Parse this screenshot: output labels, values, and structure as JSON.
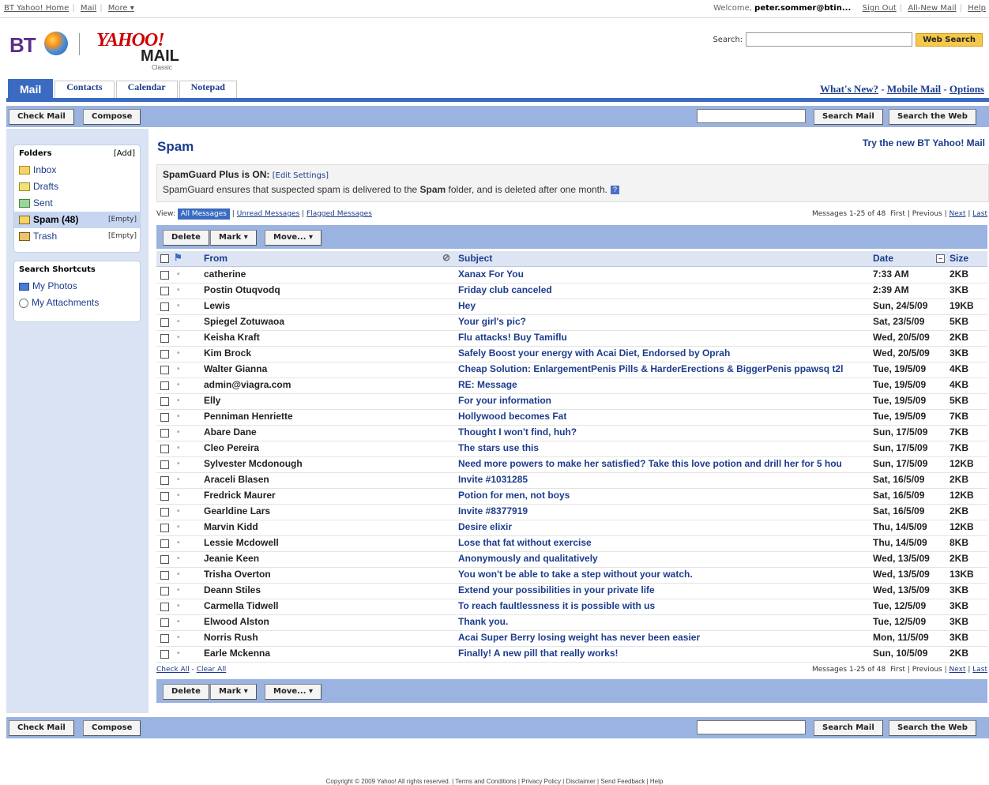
{
  "util": {
    "left_links": [
      "BT Yahoo! Home",
      "Mail",
      "More"
    ],
    "welcome": "Welcome,",
    "user": "peter.sommer@btin...",
    "right_links": [
      "Sign Out",
      "All-New Mail",
      "Help"
    ]
  },
  "logo": {
    "bt": "BT",
    "yahoo": "YAHOO!",
    "mail": "MAIL",
    "classic": "Classic"
  },
  "top_search": {
    "label": "Search:",
    "button": "Web Search"
  },
  "tabs": [
    "Mail",
    "Contacts",
    "Calendar",
    "Notepad"
  ],
  "top_links": [
    "What's New?",
    "Mobile Mail",
    "Options"
  ],
  "toolbar": {
    "check_mail": "Check Mail",
    "compose": "Compose",
    "search_mail": "Search Mail",
    "search_web": "Search the Web"
  },
  "folders": {
    "title": "Folders",
    "add": "[Add]",
    "items": [
      {
        "icon": "inbox-icon",
        "label": "Inbox",
        "empty": ""
      },
      {
        "icon": "drafts-icon",
        "label": "Drafts",
        "empty": ""
      },
      {
        "icon": "sent-icon",
        "label": "Sent",
        "empty": ""
      },
      {
        "icon": "spam-icon",
        "label": "Spam (48)",
        "empty": "[Empty]"
      },
      {
        "icon": "trash-icon",
        "label": "Trash",
        "empty": "[Empty]"
      }
    ]
  },
  "shortcuts": {
    "title": "Search Shortcuts",
    "items": [
      {
        "icon": "photos-icon",
        "label": "My Photos"
      },
      {
        "icon": "attachment-icon",
        "label": "My Attachments"
      }
    ]
  },
  "main": {
    "title": "Spam",
    "try_new": "Try the new BT Yahoo! Mail",
    "spamguard_on": "SpamGuard Plus is ON:",
    "edit_settings": "[Edit Settings]",
    "spamguard_desc_pre": "SpamGuard ensures that suspected spam is delivered to the ",
    "spamguard_desc_bold": "Spam",
    "spamguard_desc_post": " folder, and is deleted after one month."
  },
  "view": {
    "label": "View:",
    "all": "All Messages",
    "unread": "Unread Messages",
    "flagged": "Flagged Messages",
    "count": "Messages 1-25 of 48",
    "first": "First",
    "previous": "Previous",
    "next": "Next",
    "last": "Last"
  },
  "actions": {
    "delete": "Delete",
    "mark": "Mark",
    "move": "Move..."
  },
  "columns": {
    "from": "From",
    "subject": "Subject",
    "date": "Date",
    "size": "Size"
  },
  "messages": [
    {
      "from": "catherine",
      "subject": "Xanax For You",
      "date": "7:33 AM",
      "size": "2KB"
    },
    {
      "from": "Postin Otuqvodq",
      "subject": "Friday club canceled",
      "date": "2:39 AM",
      "size": "3KB"
    },
    {
      "from": "Lewis",
      "subject": "Hey",
      "date": "Sun, 24/5/09",
      "size": "19KB"
    },
    {
      "from": "Spiegel Zotuwaoa",
      "subject": "Your girl's pic?",
      "date": "Sat, 23/5/09",
      "size": "5KB"
    },
    {
      "from": "Keisha Kraft",
      "subject": "Flu attacks! Buy Tamiflu",
      "date": "Wed, 20/5/09",
      "size": "2KB"
    },
    {
      "from": "Kim Brock",
      "subject": "Safely Boost your energy with Acai Diet, Endorsed by Oprah",
      "date": "Wed, 20/5/09",
      "size": "3KB"
    },
    {
      "from": "Walter Gianna",
      "subject": "Cheap Solution: EnlargementPenis Pills & HarderErections & BiggerPenis ppawsq t2l",
      "date": "Tue, 19/5/09",
      "size": "4KB"
    },
    {
      "from": "admin@viagra.com",
      "subject": "RE: Message",
      "date": "Tue, 19/5/09",
      "size": "4KB"
    },
    {
      "from": "Elly",
      "subject": "For your information",
      "date": "Tue, 19/5/09",
      "size": "5KB"
    },
    {
      "from": "Penniman Henriette",
      "subject": "Hollywood becomes Fat",
      "date": "Tue, 19/5/09",
      "size": "7KB"
    },
    {
      "from": "Abare Dane",
      "subject": "Thought I won't find, huh?",
      "date": "Sun, 17/5/09",
      "size": "7KB"
    },
    {
      "from": "Cleo Pereira",
      "subject": "The stars use this",
      "date": "Sun, 17/5/09",
      "size": "7KB"
    },
    {
      "from": "Sylvester Mcdonough",
      "subject": "Need more powers to make her satisfied? Take this love potion and drill her for 5 hou",
      "date": "Sun, 17/5/09",
      "size": "12KB"
    },
    {
      "from": "Araceli Blasen",
      "subject": "Invite #1031285",
      "date": "Sat, 16/5/09",
      "size": "2KB"
    },
    {
      "from": "Fredrick Maurer",
      "subject": "Potion for men, not boys",
      "date": "Sat, 16/5/09",
      "size": "12KB"
    },
    {
      "from": "Gearldine Lars",
      "subject": "Invite #8377919",
      "date": "Sat, 16/5/09",
      "size": "2KB"
    },
    {
      "from": "Marvin Kidd",
      "subject": "Desire elixir",
      "date": "Thu, 14/5/09",
      "size": "12KB"
    },
    {
      "from": "Lessie Mcdowell",
      "subject": "Lose that fat without exercise",
      "date": "Thu, 14/5/09",
      "size": "8KB"
    },
    {
      "from": "Jeanie Keen",
      "subject": "Anonymously and qualitatively",
      "date": "Wed, 13/5/09",
      "size": "2KB"
    },
    {
      "from": "Trisha Overton",
      "subject": "You won't be able to take a step without your watch.",
      "date": "Wed, 13/5/09",
      "size": "13KB"
    },
    {
      "from": "Deann Stiles",
      "subject": "Extend your possibilities in your private life",
      "date": "Wed, 13/5/09",
      "size": "3KB"
    },
    {
      "from": "Carmella Tidwell",
      "subject": "To reach faultlessness it is possible with us",
      "date": "Tue, 12/5/09",
      "size": "3KB"
    },
    {
      "from": "Elwood Alston",
      "subject": "Thank you.",
      "date": "Tue, 12/5/09",
      "size": "3KB"
    },
    {
      "from": "Norris Rush",
      "subject": "Acai Super Berry losing weight has never been easier",
      "date": "Mon, 11/5/09",
      "size": "3KB"
    },
    {
      "from": "Earle Mckenna",
      "subject": "Finally! A new pill that really works!",
      "date": "Sun, 10/5/09",
      "size": "2KB"
    }
  ],
  "bottom": {
    "check_all": "Check All",
    "clear_all": "Clear All"
  },
  "footer": "Copyright © 2009 Yahoo! All rights reserved. | Terms and Conditions | Privacy Policy | Disclaimer | Send Feedback | Help"
}
